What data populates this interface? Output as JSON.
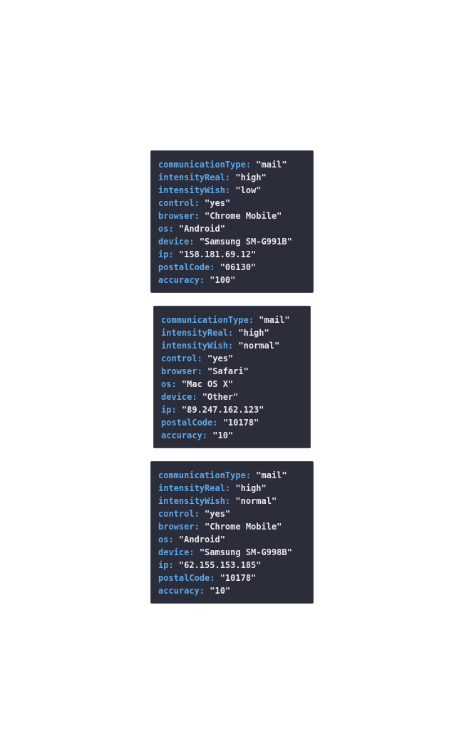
{
  "records": [
    {
      "fields": [
        {
          "key": "communicationType",
          "value": "\"mail\""
        },
        {
          "key": "intensityReal",
          "value": "\"high\""
        },
        {
          "key": "intensityWish",
          "value": "\"low\""
        },
        {
          "key": "control",
          "value": "\"yes\""
        },
        {
          "key": "browser",
          "value": "\"Chrome Mobile\""
        },
        {
          "key": "os",
          "value": "\"Android\""
        },
        {
          "key": "device",
          "value": "\"Samsung SM-G991B\""
        },
        {
          "key": "ip",
          "value": "\"158.181.69.12\""
        },
        {
          "key": "postalCode",
          "value": "\"06130\""
        },
        {
          "key": "accuracy",
          "value": "\"100\""
        }
      ]
    },
    {
      "fields": [
        {
          "key": "communicationType",
          "value": "\"mail\""
        },
        {
          "key": "intensityReal",
          "value": "\"high\""
        },
        {
          "key": "intensityWish",
          "value": "\"normal\""
        },
        {
          "key": "control",
          "value": "\"yes\""
        },
        {
          "key": "browser",
          "value": "\"Safari\""
        },
        {
          "key": "os",
          "value": "\"Mac OS X\""
        },
        {
          "key": "device",
          "value": "\"Other\""
        },
        {
          "key": "ip",
          "value": "\"89.247.162.123\""
        },
        {
          "key": "postalCode",
          "value": "\"10178\""
        },
        {
          "key": "accuracy",
          "value": "\"10\""
        }
      ]
    },
    {
      "fields": [
        {
          "key": "communicationType",
          "value": "\"mail\""
        },
        {
          "key": "intensityReal",
          "value": "\"high\""
        },
        {
          "key": "intensityWish",
          "value": "\"normal\""
        },
        {
          "key": "control",
          "value": "\"yes\""
        },
        {
          "key": "browser",
          "value": "\"Chrome Mobile\""
        },
        {
          "key": "os",
          "value": "\"Android\""
        },
        {
          "key": "device",
          "value": "\"Samsung SM-G998B\""
        },
        {
          "key": "ip",
          "value": "\"62.155.153.185\""
        },
        {
          "key": "postalCode",
          "value": "\"10178\""
        },
        {
          "key": "accuracy",
          "value": "\"10\""
        }
      ]
    }
  ],
  "colors": {
    "card_background": "#2b2d3b",
    "key": "#5ca8e8",
    "value": "#e8e8ec"
  }
}
